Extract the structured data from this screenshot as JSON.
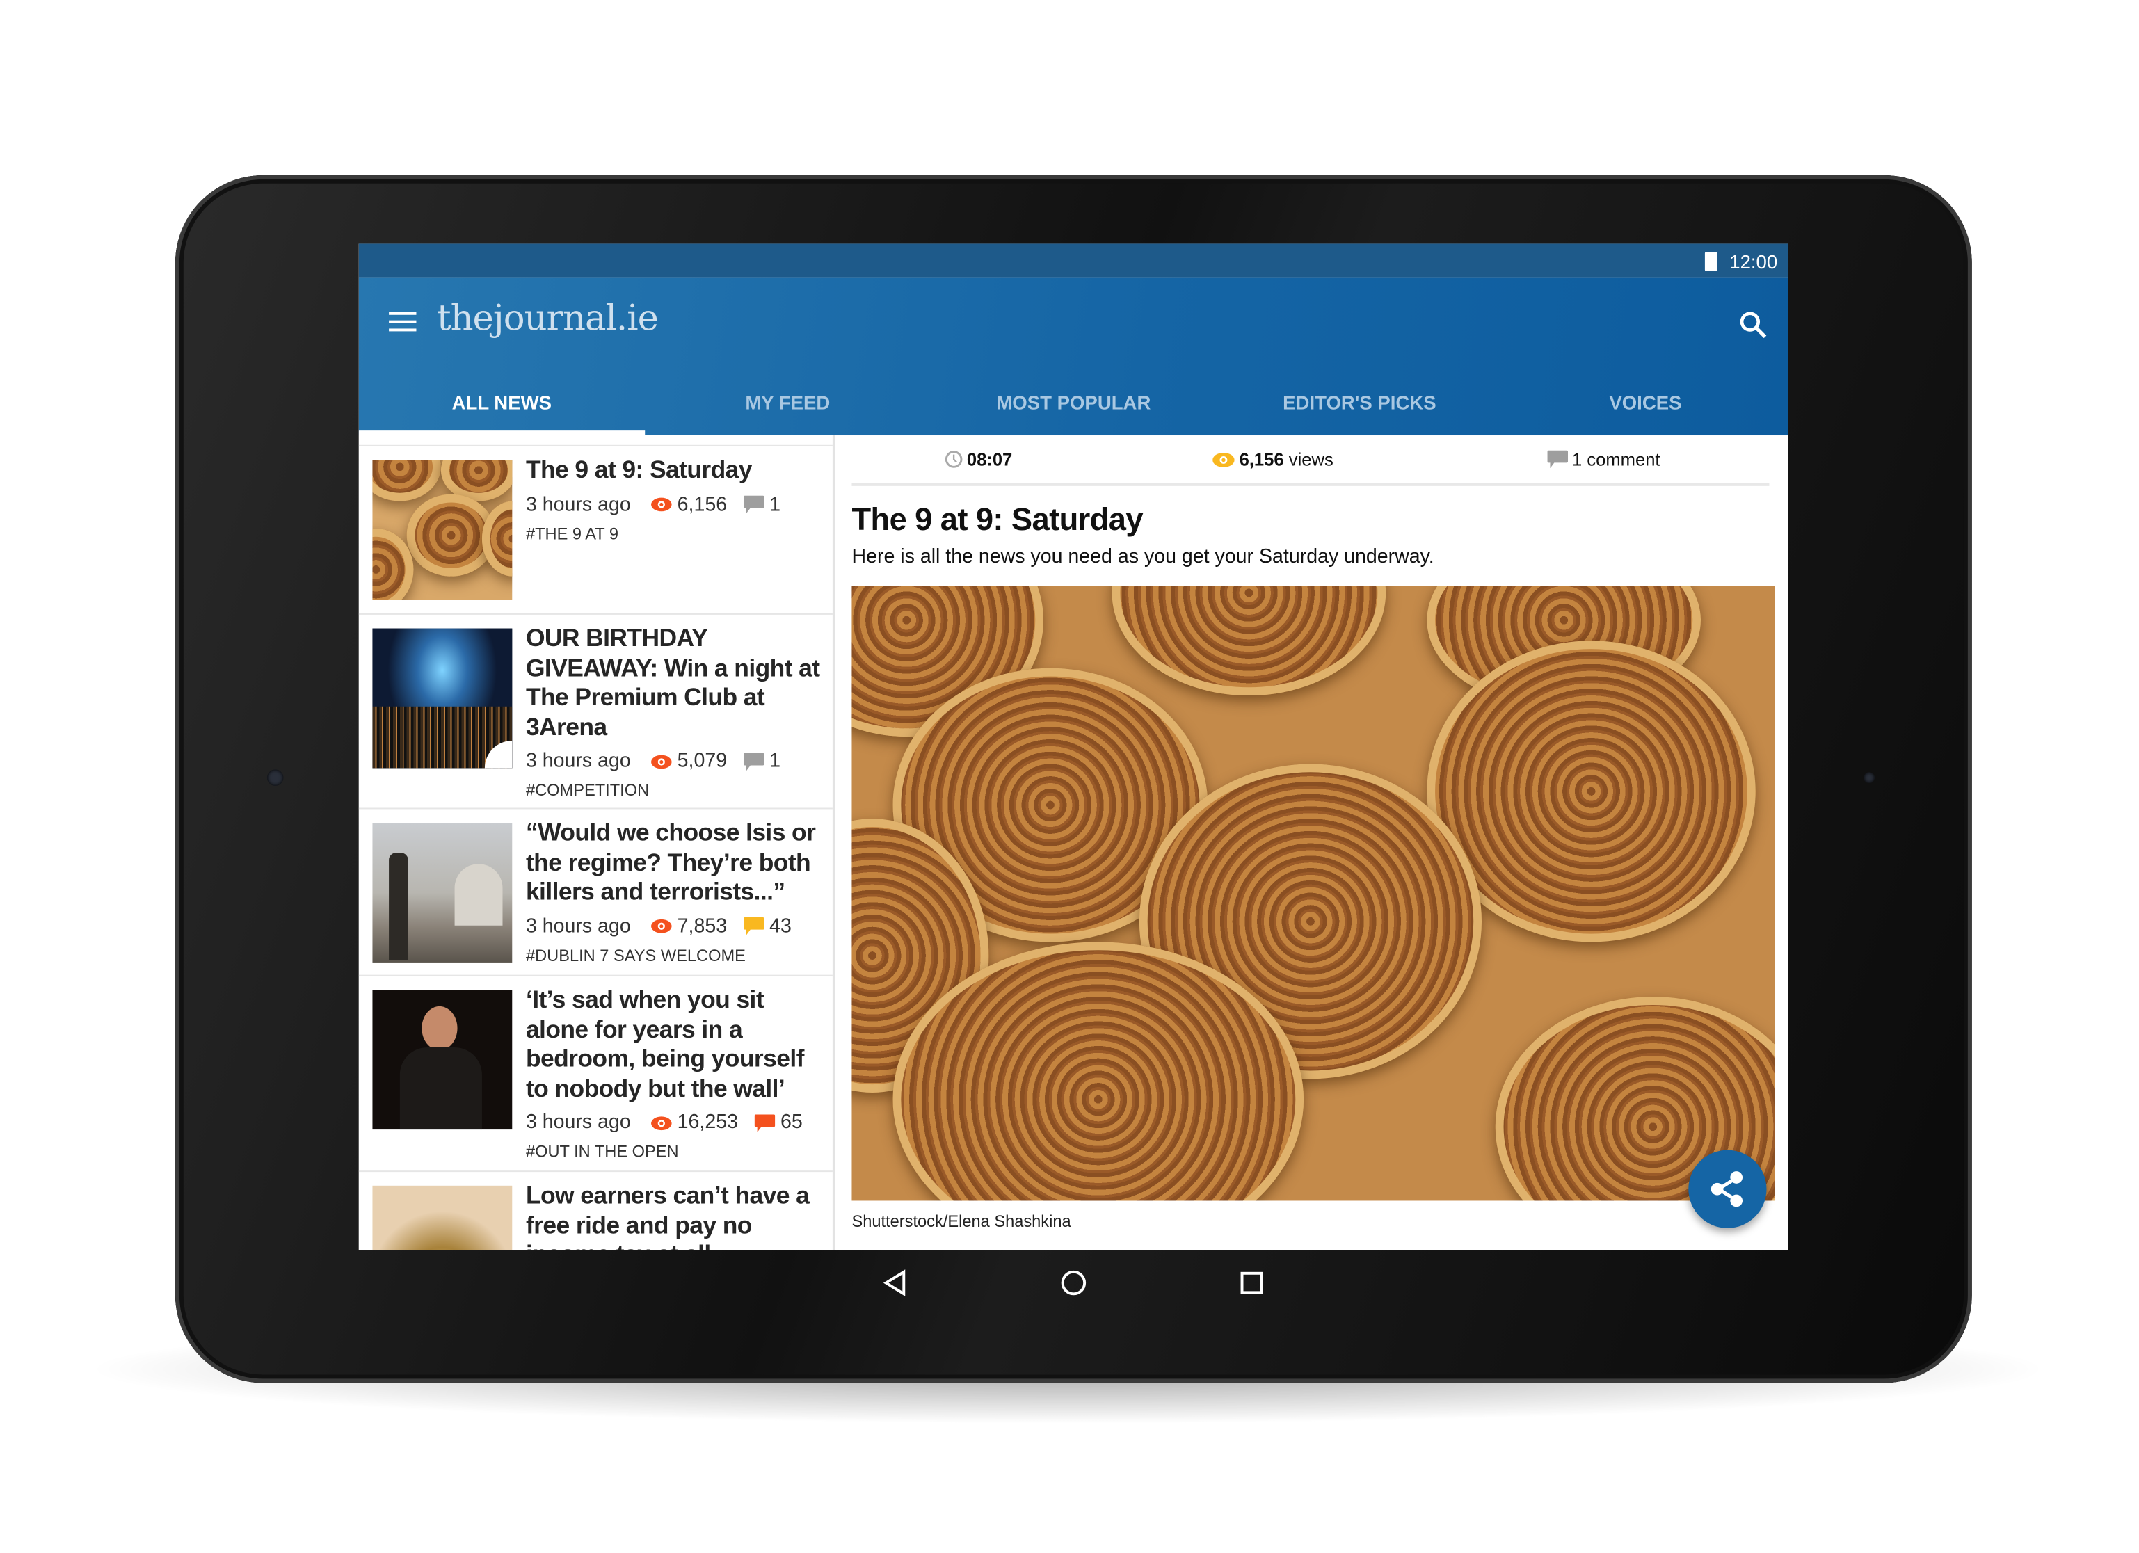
{
  "status_bar": {
    "time": "12:00"
  },
  "app": {
    "logo": "thejournal.ie",
    "accent": "#1565a5"
  },
  "tabs": [
    {
      "label": "ALL NEWS",
      "active": true
    },
    {
      "label": "MY FEED"
    },
    {
      "label": "MOST POPULAR"
    },
    {
      "label": "EDITOR'S PICKS"
    },
    {
      "label": "VOICES"
    }
  ],
  "articles": [
    {
      "title": "The 9 at 9: Saturday",
      "time": "3 hours ago",
      "views": "6,156",
      "comments": "1",
      "comment_color": "#9e9e9e",
      "tag": "#THE 9 AT 9"
    },
    {
      "title": "OUR BIRTHDAY GIVEAWAY: Win a night at The Premium Club at 3Arena",
      "time": "3 hours ago",
      "views": "5,079",
      "comments": "1",
      "comment_color": "#9e9e9e",
      "tag": "#COMPETITION"
    },
    {
      "title": "“Would we choose Isis or the regime? They’re both killers and terrorists...”",
      "time": "3 hours ago",
      "views": "7,853",
      "comments": "43",
      "comment_color": "#f9b820",
      "tag": "#DUBLIN 7 SAYS WELCOME"
    },
    {
      "title": "‘It’s sad when you sit alone for years in a bedroom, being yourself to nobody but the wall’",
      "time": "3 hours ago",
      "views": "16,253",
      "comments": "65",
      "comment_color": "#f4511e",
      "tag": "#OUT IN THE OPEN"
    },
    {
      "title": "Low earners can’t have a free ride and pay no income tax at all",
      "time": "",
      "views": "",
      "comments": "",
      "tag": ""
    }
  ],
  "detail": {
    "time": "08:07",
    "views": "6,156",
    "views_label": "views",
    "comments": "1 comment",
    "title": "The 9 at 9: Saturday",
    "subtitle": "Here is all the news you need as you get your Saturday underway.",
    "caption": "Shutterstock/Elena Shashkina"
  },
  "icons": {
    "menu": "hamburger-icon",
    "search": "search-icon",
    "views": "eye-icon",
    "comments": "comment-bubble-icon",
    "time": "clock-icon",
    "share": "share-icon"
  }
}
